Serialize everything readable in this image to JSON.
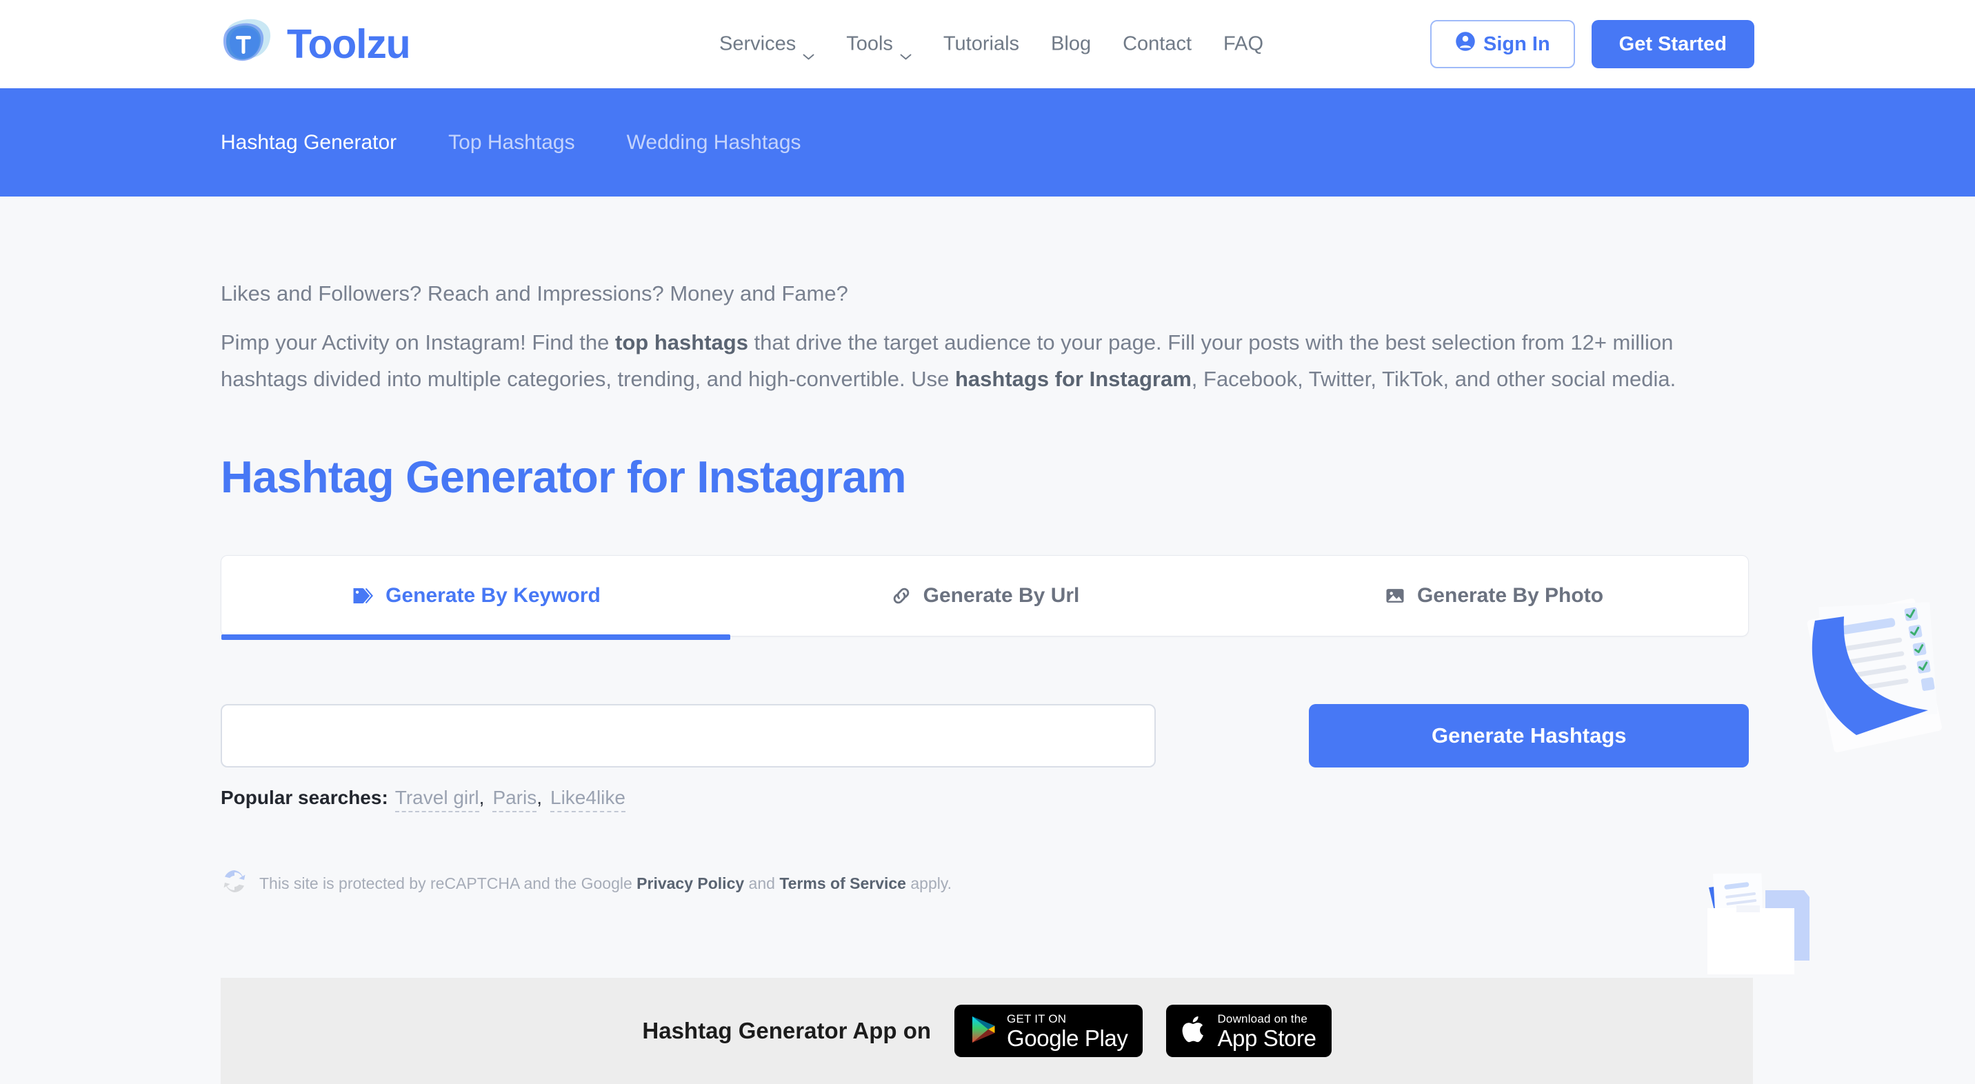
{
  "brand": {
    "name": "Toolzu",
    "logo_letter": "T",
    "accent": "#4778F5"
  },
  "header": {
    "nav": [
      {
        "label": "Services",
        "has_dropdown": true,
        "icon": "chevron-down-icon"
      },
      {
        "label": "Tools",
        "has_dropdown": true,
        "icon": "chevron-down-icon"
      },
      {
        "label": "Tutorials",
        "has_dropdown": false
      },
      {
        "label": "Blog",
        "has_dropdown": false
      },
      {
        "label": "Contact",
        "has_dropdown": false
      },
      {
        "label": "FAQ",
        "has_dropdown": false
      }
    ],
    "sign_in": {
      "label": "Sign In",
      "icon": "user-account-icon"
    },
    "get_started": {
      "label": "Get Started"
    }
  },
  "subnav": {
    "items": [
      {
        "label": "Hashtag Generator",
        "active": true
      },
      {
        "label": "Top Hashtags",
        "active": false
      },
      {
        "label": "Wedding Hashtags",
        "active": false
      }
    ]
  },
  "main": {
    "lead": "Likes and Followers? Reach and Impressions? Money and Fame?",
    "description_parts": [
      {
        "text": "Pimp your Activity on Instagram! Find the ",
        "bold": false
      },
      {
        "text": "top hashtags",
        "bold": true
      },
      {
        "text": " that drive the target audience to your page. Fill your posts with the best selection from 12+ million hashtags divided into multiple categories, trending, and high-convertible. Use ",
        "bold": false
      },
      {
        "text": "hashtags for Instagram",
        "bold": true
      },
      {
        "text": ", Facebook, Twitter, TikTok, and other social media.",
        "bold": false
      }
    ],
    "heading": "Hashtag Generator for Instagram",
    "tabs": [
      {
        "label": "Generate By Keyword",
        "icon": "tag-icon",
        "active": true
      },
      {
        "label": "Generate By Url",
        "icon": "link-icon",
        "active": false
      },
      {
        "label": "Generate By Photo",
        "icon": "image-icon",
        "active": false
      }
    ],
    "search": {
      "value": "",
      "placeholder": ""
    },
    "generate_button": {
      "label": "Generate Hashtags"
    },
    "popular": {
      "label": "Popular searches:",
      "items": [
        "Travel girl",
        "Paris",
        "Like4like"
      ],
      "separator": ","
    },
    "recaptcha": {
      "icon": "recaptcha-icon",
      "prefix": "This site is protected by reCAPTCHA and the Google ",
      "privacy_link": "Privacy Policy",
      "middle": " and ",
      "terms_link": "Terms of Service",
      "suffix": " apply."
    }
  },
  "appbar": {
    "title": "Hashtag Generator App on",
    "badges": [
      {
        "icon": "google-play-icon",
        "small": "GET IT ON",
        "big": "Google Play"
      },
      {
        "icon": "apple-icon",
        "small": "Download on the",
        "big": "App Store"
      }
    ]
  },
  "decorations": [
    {
      "name": "checklist-papers-illustration"
    },
    {
      "name": "folder-documents-illustration"
    }
  ]
}
